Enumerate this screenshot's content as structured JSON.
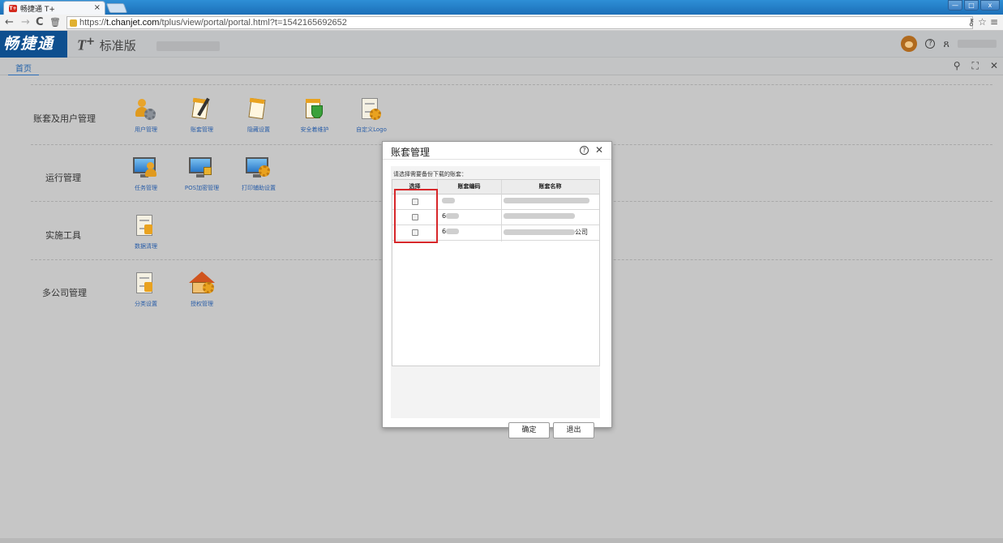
{
  "browser": {
    "tab_title": "畅捷通 T+",
    "tab_favicon": "T+",
    "tab_close": "×",
    "url_scheme": "https://",
    "url_host": "t.chanjet.com",
    "url_path": "/tplus/view/portal/portal.html?t=1542165692652",
    "nav_back": "←",
    "nav_forward": "→",
    "nav_reload": "C",
    "nav_trash": "🗑",
    "win_min": "—",
    "win_max": "□",
    "win_close": "x",
    "addr_key": "⚷",
    "addr_star": "☆",
    "addr_menu": "≡"
  },
  "header": {
    "logo": "畅捷通",
    "product_t": "T",
    "product_plus": "+",
    "product_edition": "标准版",
    "help_icon": "?",
    "user_icon": "ጸ"
  },
  "tabstrip": {
    "home_tab": "首页",
    "search_icon": "⚲",
    "fullscreen_icon": "⛶",
    "close_icon": "✕"
  },
  "groups": [
    {
      "label": "账套及用户管理",
      "tiles": [
        "用户管理",
        "账套管理",
        "隐藏设置",
        "安全着维护",
        "自定义Logo"
      ]
    },
    {
      "label": "运行管理",
      "tiles": [
        "任务管理",
        "POS加密管理",
        "打印辅助设置"
      ]
    },
    {
      "label": "实施工具",
      "tiles": [
        "数据清理"
      ]
    },
    {
      "label": "多公司管理",
      "tiles": [
        "分类设置",
        "授权管理"
      ]
    }
  ],
  "dialog": {
    "title": "账套管理",
    "help_icon": "?",
    "close_icon": "✕",
    "hint": "请选择需要备份下载的账套：",
    "columns": [
      "选择",
      "账套编码",
      "账套名称"
    ],
    "rows": [
      {
        "code": "",
        "name": ""
      },
      {
        "code": "6",
        "name": ""
      },
      {
        "code": "6",
        "name": "公司"
      }
    ],
    "ok_label": "确定",
    "exit_label": "退出"
  },
  "colors": {
    "logo_bg": "#0e4f8f",
    "link_blue": "#2a5ea8",
    "highlight_red": "#d7272a"
  }
}
